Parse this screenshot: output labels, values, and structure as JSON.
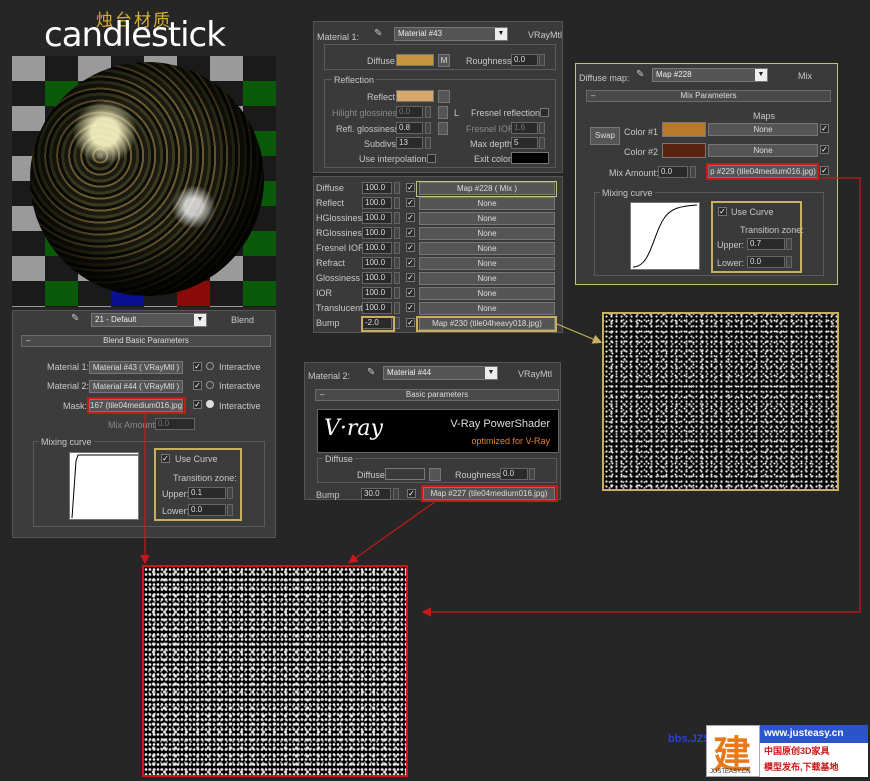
{
  "title": {
    "cn": "烛台材质",
    "en": "candlestick"
  },
  "left_panel": {
    "slot": "21 - Default",
    "type": "Blend",
    "rollout": "Blend Basic Parameters",
    "m1_label": "Material 1:",
    "m1_value": "Material #43  ( VRayMtl )",
    "m1_interactive": "Interactive",
    "m2_label": "Material 2:",
    "m2_value": "Material #44  ( VRayMtl )",
    "m2_interactive": "Interactive",
    "mask_label": "Mask:",
    "mask_value": "167 (tile04medium016.jpg)",
    "mask_interactive": "Interactive",
    "mix_label": "Mix Amount:",
    "mix_value": "0.0",
    "curve_group": "Mixing curve",
    "use_curve": "Use Curve",
    "tz": "Transition zone:",
    "upper_label": "Upper:",
    "upper_value": "0.1",
    "lower_label": "Lower:",
    "lower_value": "0.0"
  },
  "mat1": {
    "label": "Material 1:",
    "name": "Material #43",
    "type": "VRayMtl",
    "diffuse_label": "Diffuse",
    "diffuse_btn": "M",
    "rough_label": "Roughness",
    "rough_value": "0.0",
    "refl_group": "Reflection",
    "reflect_label": "Reflect",
    "hgloss_label": "Hilight glossiness",
    "hgloss_value": "0.0",
    "L": "L",
    "fresnel_label": "Fresnel reflections",
    "rgloss_label": "Refl. glossiness",
    "rgloss_value": "0.8",
    "fior_label": "Fresnel IOR",
    "fior_value": "1.6",
    "subdivs_label": "Subdivs",
    "subdivs_value": "13",
    "maxd_label": "Max depth",
    "maxd_value": "5",
    "interp_label": "Use interpolation",
    "exit_label": "Exit color",
    "colors": {
      "diffuse": "#c8963c",
      "reflect": "#d8a868",
      "exit": "#000000"
    }
  },
  "maps": {
    "rows": [
      {
        "label": "Diffuse",
        "value": "100.0",
        "map": "Map #228  ( Mix )"
      },
      {
        "label": "Reflect",
        "value": "100.0",
        "map": "None"
      },
      {
        "label": "HGlossiness",
        "value": "100.0",
        "map": "None"
      },
      {
        "label": "RGlossiness",
        "value": "100.0",
        "map": "None"
      },
      {
        "label": "Fresnel IOR",
        "value": "100.0",
        "map": "None"
      },
      {
        "label": "Refract",
        "value": "100.0",
        "map": "None"
      },
      {
        "label": "Glossiness",
        "value": "100.0",
        "map": "None"
      },
      {
        "label": "IOR",
        "value": "100.0",
        "map": "None"
      },
      {
        "label": "Translucent",
        "value": "100.0",
        "map": "None"
      },
      {
        "label": "Bump",
        "value": "-2.0",
        "map": "Map #230 (tile04heavy018.jpg)"
      }
    ]
  },
  "diffuse_map": {
    "label": "Diffuse map:",
    "name": "Map #228",
    "type": "Mix",
    "rollout": "Mix Parameters",
    "maps_header": "Maps",
    "swap": "Swap",
    "c1_label": "Color #1",
    "c1_map": "None",
    "c2_label": "Color #2",
    "c2_map": "None",
    "mix_label": "Mix Amount:",
    "mix_value": "0.0",
    "mix_map": "p #229 (tile04medium016.jpg)",
    "curve_group": "Mixing curve",
    "use_curve": "Use Curve",
    "tz": "Transition zone:",
    "upper_label": "Upper:",
    "upper_value": "0.7",
    "lower_label": "Lower:",
    "lower_value": "0.0",
    "colors": {
      "c1": "#b87a28",
      "c2": "#5a2410"
    }
  },
  "mat2": {
    "label": "Material 2:",
    "name": "Material #44",
    "type": "VRayMtl",
    "rollout": "Basic parameters",
    "vray_logo": "V·ray",
    "banner_title": "V-Ray PowerShader",
    "banner_sub": "optimized for V-Ray",
    "diffuse_group": "Diffuse",
    "diffuse_label": "Diffuse",
    "rough_label": "Roughness",
    "rough_value": "0.0",
    "bump_label": "Bump",
    "bump_value": "30.0",
    "bump_map": "Map #227 (tile04medium016.jpg)"
  },
  "watermark": {
    "url": "bbs.JZSCN.com",
    "site": "www.justeasy.cn",
    "line1": "中国原创3D家具",
    "line2": "模型发布,下载基地",
    "logo_sub": "JUSTEASY.CN"
  }
}
